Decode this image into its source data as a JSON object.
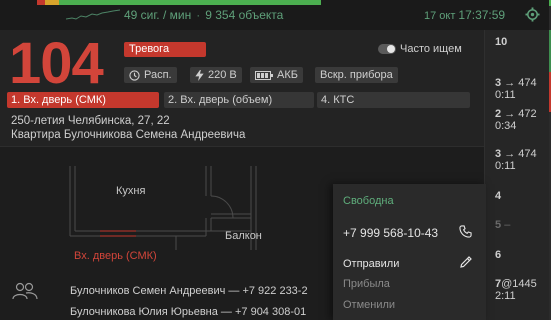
{
  "topbar": {
    "segments": [
      {
        "color": "#c4382d",
        "weight": 8
      },
      {
        "color": "#d7a32b",
        "weight": 14
      },
      {
        "color": "#4caf50",
        "weight": 262
      }
    ],
    "signals_rate": "49 сиг. / мин",
    "separator": "·",
    "objects": "9 354 объекта",
    "date": "17 окт",
    "time": "17:37:59",
    "settings_icon": "gear-icon"
  },
  "alarm": {
    "number": "104",
    "status": "Тревога",
    "often_label": "Часто ищем",
    "chips": {
      "schedule": "Расп.",
      "voltage": "220 В",
      "battery": "АКБ",
      "tamper": "Вскр. прибора"
    },
    "zones": [
      "1. Вх. дверь (СМК)",
      "2. Вх. дверь (объем)",
      "4. КТС"
    ],
    "address": "250-летия Челябинска, 27, 22",
    "apartment": "Квартира Булочникова Семена Андреевича"
  },
  "plan": {
    "kitchen": "Кухня",
    "balcony": "Балкон",
    "door_label": "Вх. дверь (СМК)"
  },
  "contacts": [
    "Булочников Семен Андреевич — +7 922 233-2",
    "Булочникова Юлия Юрьевна — +7 904 308-01"
  ],
  "dropdown": {
    "status": "Свободна",
    "phone": "+7 999 568-10-43",
    "sent": "Отправили",
    "arrived": "Прибыла",
    "canceled": "Отменили"
  },
  "sidebar": {
    "items": [
      {
        "num": "10",
        "sub": ""
      },
      {
        "num": "3",
        "sub": "→ 474",
        "time": "0:11"
      },
      {
        "num": "2",
        "sub": "→ 472",
        "time": "0:34"
      },
      {
        "num": "3",
        "sub": "→ 474",
        "time": "0:11"
      },
      {
        "num": "4",
        "sub": ""
      },
      {
        "num": "5",
        "sub": "–"
      },
      {
        "num": "6",
        "sub": ""
      },
      {
        "num": "7",
        "sub": "@1445",
        "time": "2:11"
      }
    ]
  },
  "colors": {
    "accent_red": "#c4382d",
    "accent_green": "#5fae7c",
    "background": "#1d1d1d"
  }
}
